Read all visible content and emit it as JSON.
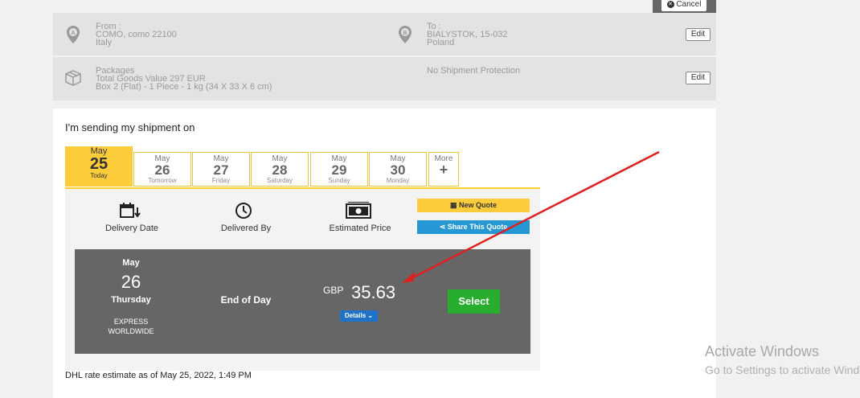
{
  "cancel": {
    "label": "Cancel"
  },
  "from": {
    "label": "From :",
    "line1": "COMO, como 22100",
    "line2": "Italy",
    "marker": "A"
  },
  "to": {
    "label": "To :",
    "line1": "BIALYSTOK, 15-032",
    "line2": "Poland",
    "marker": "B"
  },
  "edit_label": "Edit",
  "packages": {
    "label": "Packages",
    "value_line": "Total Goods Value 297 EUR",
    "box_line": "Box 2 (Flat) - 1 Piece - 1 kg (34 X 33 X 6 cm)",
    "protection": "No Shipment Protection"
  },
  "heading": "I'm sending my shipment on",
  "tabs": [
    {
      "month": "May",
      "day": "25",
      "weekday": "Today"
    },
    {
      "month": "May",
      "day": "26",
      "weekday": "Tomorrow"
    },
    {
      "month": "May",
      "day": "27",
      "weekday": "Friday"
    },
    {
      "month": "May",
      "day": "28",
      "weekday": "Saturday"
    },
    {
      "month": "May",
      "day": "29",
      "weekday": "Sunday"
    },
    {
      "month": "May",
      "day": "30",
      "weekday": "Monday"
    },
    {
      "month": "More",
      "day": "+",
      "weekday": ""
    }
  ],
  "columns": {
    "delivery_date": "Delivery Date",
    "delivered_by": "Delivered By",
    "estimated_price": "Estimated Price"
  },
  "new_quote": "New Quote",
  "share_quote": "Share This Quote",
  "result": {
    "month": "May",
    "day": "26",
    "weekday": "Thursday",
    "service_line1": "EXPRESS",
    "service_line2": "WORLDWIDE",
    "delivered_by": "End of Day",
    "currency": "GBP",
    "price": "35.63",
    "details": "Details",
    "select": "Select"
  },
  "estimate_note": "DHL rate estimate as of May 25, 2022, 1:49 PM",
  "watermark": {
    "title": "Activate Windows",
    "subtitle": "Go to Settings to activate Windows."
  },
  "colors": {
    "accent": "#fccc3a",
    "select": "#27ae2f",
    "arrow": "#e0201e",
    "share": "#2497d4"
  }
}
